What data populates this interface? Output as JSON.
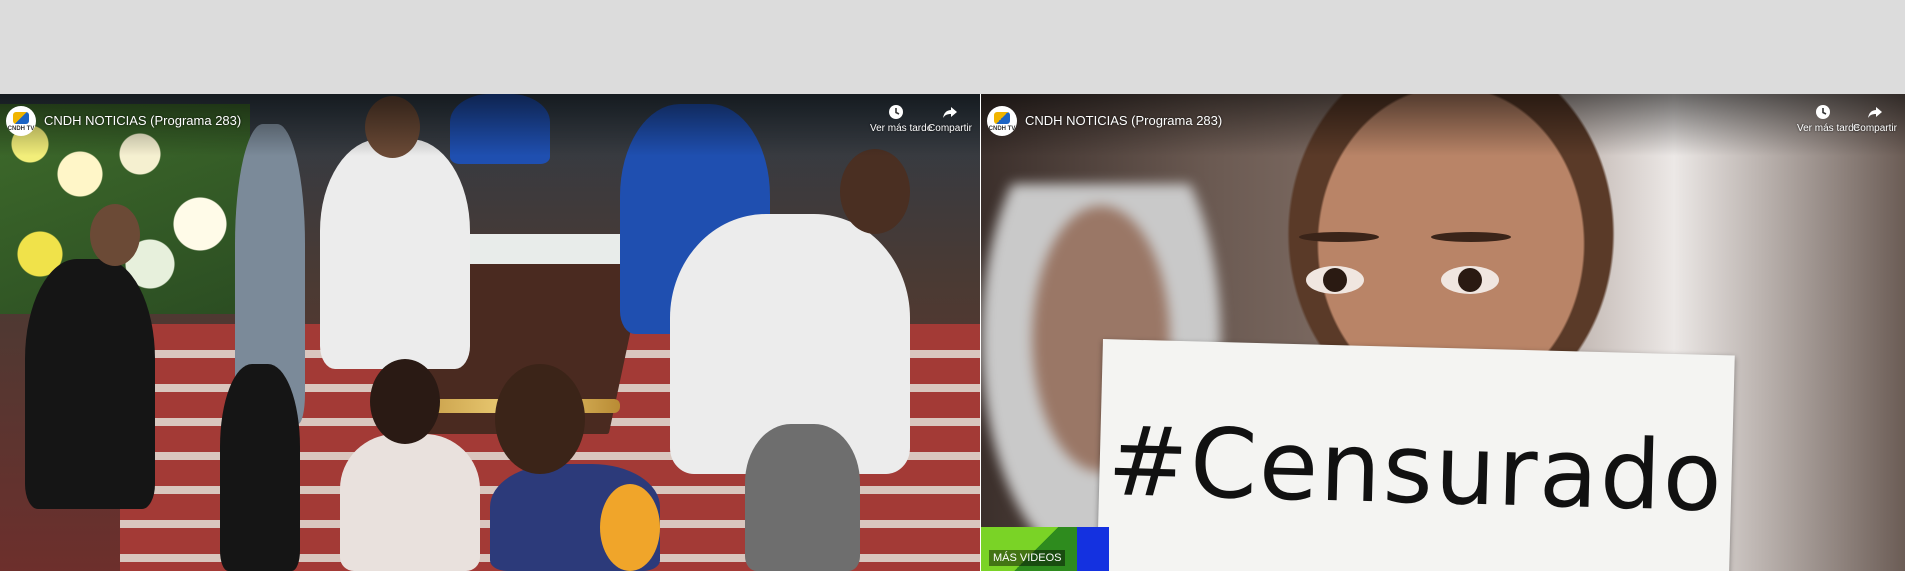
{
  "players": [
    {
      "title": "CNDH NOTICIAS (Programa 283)",
      "channel_logo_text": "CNDH TV",
      "watch_later_label": "Ver más tarde",
      "share_label": "Compartir"
    },
    {
      "title": "CNDH NOTICIAS (Programa 283)",
      "channel_logo_text": "CNDH TV",
      "watch_later_label": "Ver más tarde",
      "share_label": "Compartir",
      "sign_text": "#Censurado",
      "more_videos_label": "MÁS VIDEOS"
    }
  ],
  "icons": {
    "watch_later": "clock-icon",
    "share": "share-arrow-icon"
  },
  "colors": {
    "page_top_band": "#dcdcdc",
    "more_videos_bg": "#1431e0",
    "title_text": "#ffffff"
  }
}
